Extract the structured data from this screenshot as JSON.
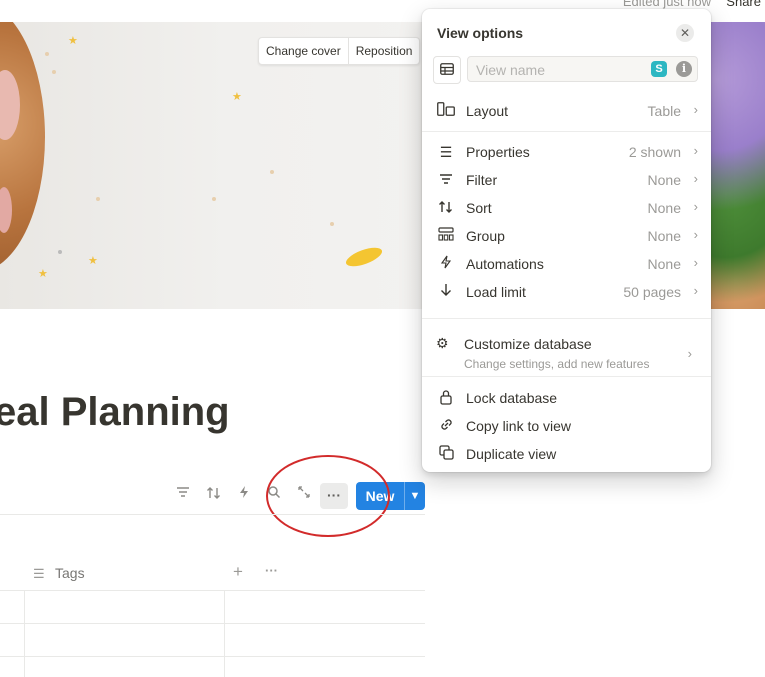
{
  "topbar": {
    "edited": "Edited just now",
    "share": "Share"
  },
  "cover": {
    "change_cover": "Change cover",
    "reposition": "Reposition"
  },
  "page": {
    "title": "eal Planning"
  },
  "toolbar": {
    "new_label": "New"
  },
  "table": {
    "tags_header": "Tags"
  },
  "view_options": {
    "title": "View options",
    "view_name_placeholder": "View name",
    "items": [
      {
        "label": "Layout",
        "value": "Table"
      },
      {
        "label": "Properties",
        "value": "2 shown"
      },
      {
        "label": "Filter",
        "value": "None"
      },
      {
        "label": "Sort",
        "value": "None"
      },
      {
        "label": "Group",
        "value": "None"
      },
      {
        "label": "Automations",
        "value": "None"
      },
      {
        "label": "Load limit",
        "value": "50 pages"
      }
    ],
    "customize": {
      "label": "Customize database",
      "sub": "Change settings, add new features"
    },
    "actions": [
      {
        "label": "Lock database"
      },
      {
        "label": "Copy link to view"
      },
      {
        "label": "Duplicate view"
      }
    ]
  },
  "colors": {
    "accent": "#2383e2",
    "highlight": "#fff700",
    "annotation": "#d22b2b"
  }
}
